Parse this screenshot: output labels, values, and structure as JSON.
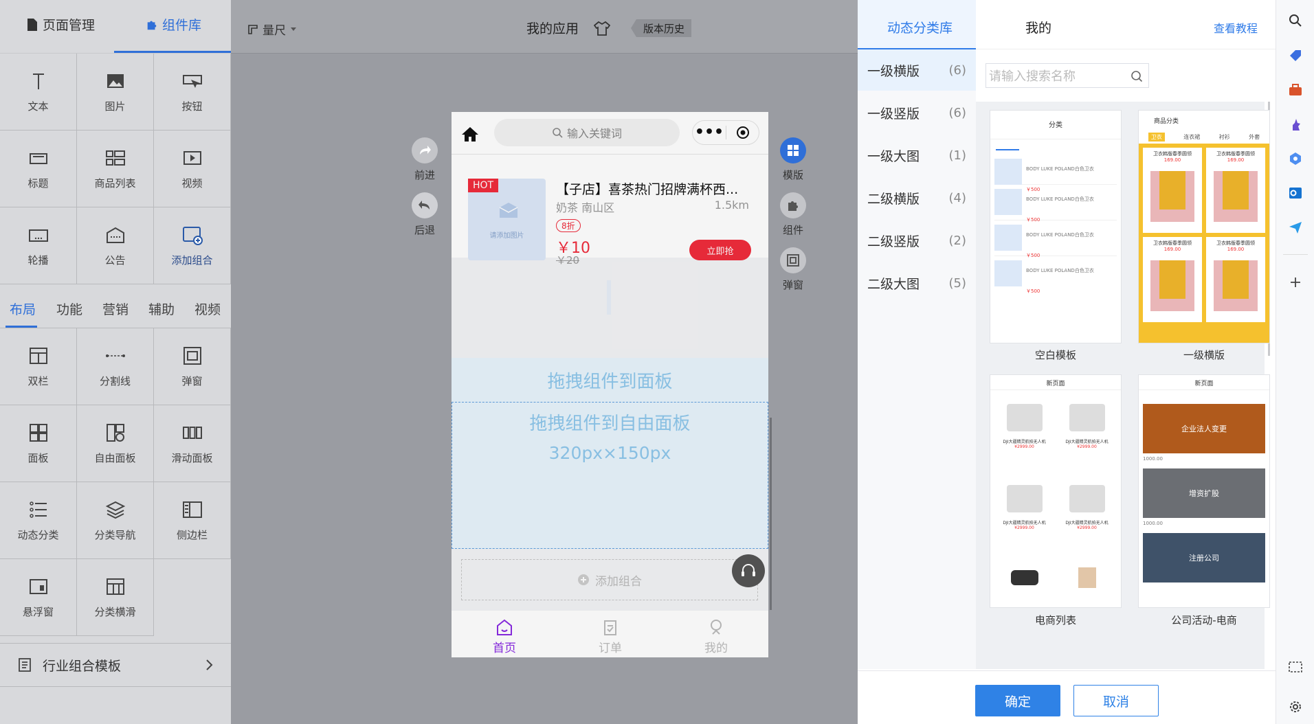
{
  "left": {
    "tabs": [
      "页面管理",
      "组件库"
    ],
    "basic_components": [
      "文本",
      "图片",
      "按钮",
      "标题",
      "商品列表",
      "视频",
      "轮播",
      "公告",
      "添加组合"
    ],
    "sub_tabs": [
      "布局",
      "功能",
      "营销",
      "辅助",
      "视频"
    ],
    "layout_components": [
      "双栏",
      "分割线",
      "弹窗",
      "面板",
      "自由面板",
      "滑动面板",
      "动态分类",
      "分类导航",
      "侧边栏",
      "悬浮窗",
      "分类横滑"
    ],
    "industry_template": "行业组合模板"
  },
  "topbar": {
    "ruler": "量尺",
    "app_name": "我的应用",
    "version_history": "版本历史"
  },
  "side_left": [
    {
      "label": "前进"
    },
    {
      "label": "后退"
    }
  ],
  "side_right": [
    {
      "label": "模版"
    },
    {
      "label": "组件"
    },
    {
      "label": "弹窗"
    }
  ],
  "phone": {
    "search_placeholder": "输入关键词",
    "product": {
      "badge": "HOT",
      "image_placeholder": "请添加图片",
      "title": "【子店】喜茶热门招牌满杯西...",
      "shop": "奶茶 南山区",
      "distance": "1.5km",
      "discount": "8折",
      "price": "￥10",
      "original_price": "￥20",
      "buy_button": "立即抢"
    },
    "drop_panel": "拖拽组件到面板",
    "free_panel": "拖拽组件到自由面板",
    "free_panel_size": "320px×150px",
    "add_combo": "添加组合",
    "nav": [
      "首页",
      "订单",
      "我的"
    ]
  },
  "right": {
    "tabs": [
      "动态分类库",
      "我的"
    ],
    "tutorial_link": "查看教程",
    "categories": [
      {
        "name": "一级横版",
        "count": "(6)"
      },
      {
        "name": "一级竖版",
        "count": "(6)"
      },
      {
        "name": "一级大图",
        "count": "(1)"
      },
      {
        "name": "二级横版",
        "count": "(4)"
      },
      {
        "name": "二级竖版",
        "count": "(2)"
      },
      {
        "name": "二级大图",
        "count": "(5)"
      }
    ],
    "search_placeholder": "请输入搜索名称",
    "templates": [
      "空白模板",
      "一级横版",
      "电商列表",
      "公司活动-电商"
    ],
    "thumb_texts": {
      "blank_title": "分类",
      "blank_item": "BODY LUKE POLAND白色卫衣",
      "blank_price": "￥500",
      "cat_title": "商品分类",
      "cat_tabs": [
        "卫衣",
        "连衣裙",
        "衬衫",
        "外套"
      ],
      "cat_item": "卫衣韩版春季圆领",
      "cat_price": "169.00",
      "shop_title": "新页面",
      "shop_item": "DJI大疆精灵航拍无人机",
      "shop_price": "¥2999.00",
      "banner1": "企业法人变更",
      "banner2": "增资扩股",
      "banner3": "注册公司",
      "banner_price": "1000.00"
    },
    "confirm": "确定",
    "cancel": "取消"
  },
  "colors": {
    "accent": "#2f7be8",
    "confirm_bg": "#2f82e6",
    "hot_red": "#f02c3c",
    "nav_purple": "#8a2be2",
    "panel_blue": "#e8f4fc"
  }
}
